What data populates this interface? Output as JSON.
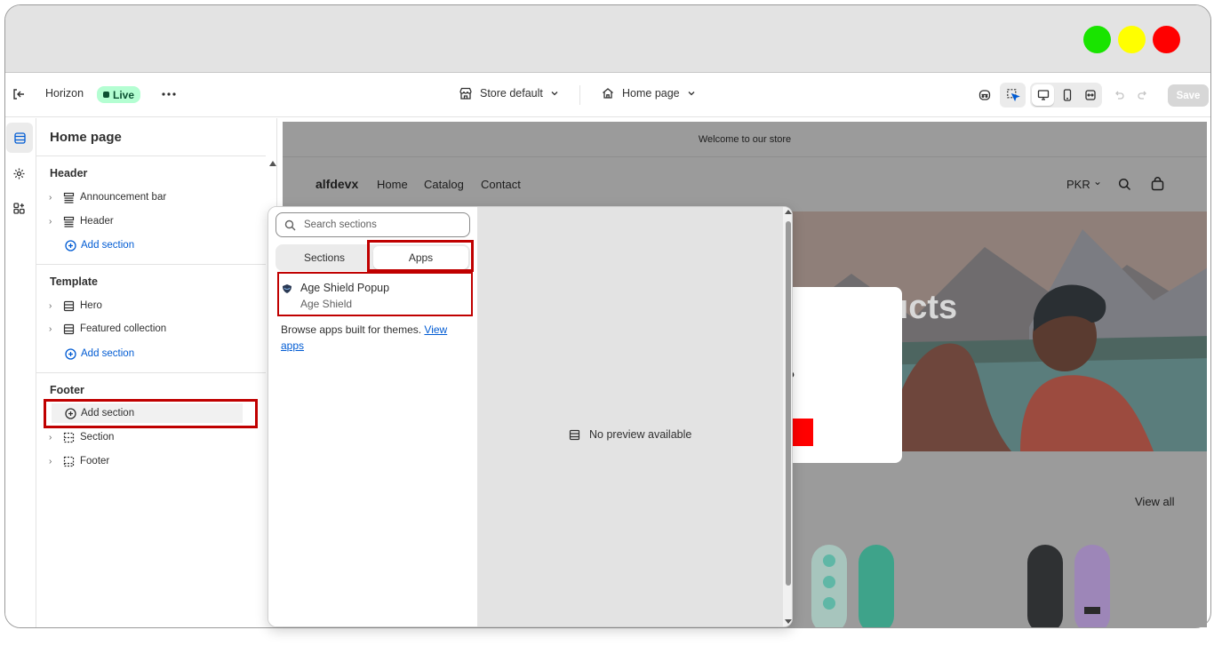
{
  "window": {
    "lights": [
      {
        "name": "green",
        "color": "#19e400"
      },
      {
        "name": "yellow",
        "color": "#ffff00"
      },
      {
        "name": "red",
        "color": "#ff0000"
      }
    ]
  },
  "topbar": {
    "store_name": "Horizon",
    "status": "Live",
    "context": "Store default",
    "page_select": "Home page",
    "save_label": "Save"
  },
  "panel": {
    "title": "Home page",
    "groups": {
      "header": {
        "title": "Header",
        "items": [
          "Announcement bar",
          "Header"
        ],
        "add": "Add section"
      },
      "template": {
        "title": "Template",
        "items": [
          "Hero",
          "Featured collection"
        ],
        "add": "Add section"
      },
      "footer": {
        "title": "Footer",
        "add": "Add section",
        "items": [
          "Section",
          "Footer"
        ]
      }
    }
  },
  "picker": {
    "search_placeholder": "Search sections",
    "tabs": [
      "Sections",
      "Apps"
    ],
    "active_tab": "Apps",
    "app": {
      "name": "Age Shield Popup",
      "vendor": "Age Shield"
    },
    "browse_text": "Browse apps built for themes.",
    "browse_link": "View apps",
    "preview_empty": "No preview available"
  },
  "preview": {
    "announcement": "Welcome to our store",
    "brand": "alfdevx",
    "nav": [
      "Home",
      "Catalog",
      "Contact"
    ],
    "currency": "PKR",
    "hero_text": "ucts",
    "modal_char": "?",
    "view_all": "View all"
  },
  "colors": {
    "accent": "#005bd3",
    "highlight": "#c00000",
    "live_bg": "#b4fed2"
  }
}
